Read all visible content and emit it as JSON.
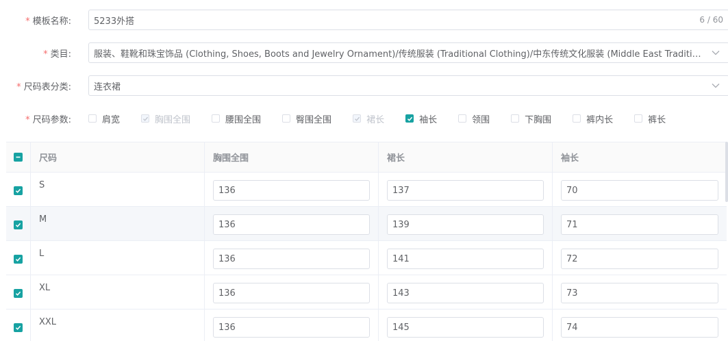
{
  "template_name": {
    "label": "模板名称:",
    "value": "5233外搭",
    "counter": "6 / 60"
  },
  "category": {
    "label": "类目:",
    "value": "服装、鞋靴和珠宝饰品 (Clothing, Shoes, Boots and Jewelry Ornament)/传统服装 (Traditional Clothing)/中东传统文化服装 (Middle East Traditional ..."
  },
  "size_chart_class": {
    "label": "尺码表分类:",
    "value": "连衣裙"
  },
  "size_params": {
    "label": "尺码参数:",
    "options": [
      {
        "label": "肩宽",
        "state": "unchecked"
      },
      {
        "label": "胸围全围",
        "state": "disabled-checked"
      },
      {
        "label": "腰围全围",
        "state": "unchecked"
      },
      {
        "label": "臀围全围",
        "state": "unchecked"
      },
      {
        "label": "裙长",
        "state": "disabled-checked"
      },
      {
        "label": "袖长",
        "state": "checked"
      },
      {
        "label": "领围",
        "state": "unchecked"
      },
      {
        "label": "下胸围",
        "state": "unchecked"
      },
      {
        "label": "裤内长",
        "state": "unchecked"
      },
      {
        "label": "裤长",
        "state": "unchecked"
      }
    ]
  },
  "table": {
    "headers": [
      "尺码",
      "胸围全围",
      "裙长",
      "袖长"
    ],
    "rows": [
      {
        "size": "S",
        "chest": "136",
        "skirt": "137",
        "sleeve": "70"
      },
      {
        "size": "M",
        "chest": "136",
        "skirt": "139",
        "sleeve": "71"
      },
      {
        "size": "L",
        "chest": "136",
        "skirt": "141",
        "sleeve": "72"
      },
      {
        "size": "XL",
        "chest": "136",
        "skirt": "143",
        "sleeve": "73"
      },
      {
        "size": "XXL",
        "chest": "136",
        "skirt": "145",
        "sleeve": "74"
      }
    ]
  },
  "colors": {
    "accent": "#17a2a2",
    "required": "#f56c6c",
    "border": "#dcdfe6"
  }
}
